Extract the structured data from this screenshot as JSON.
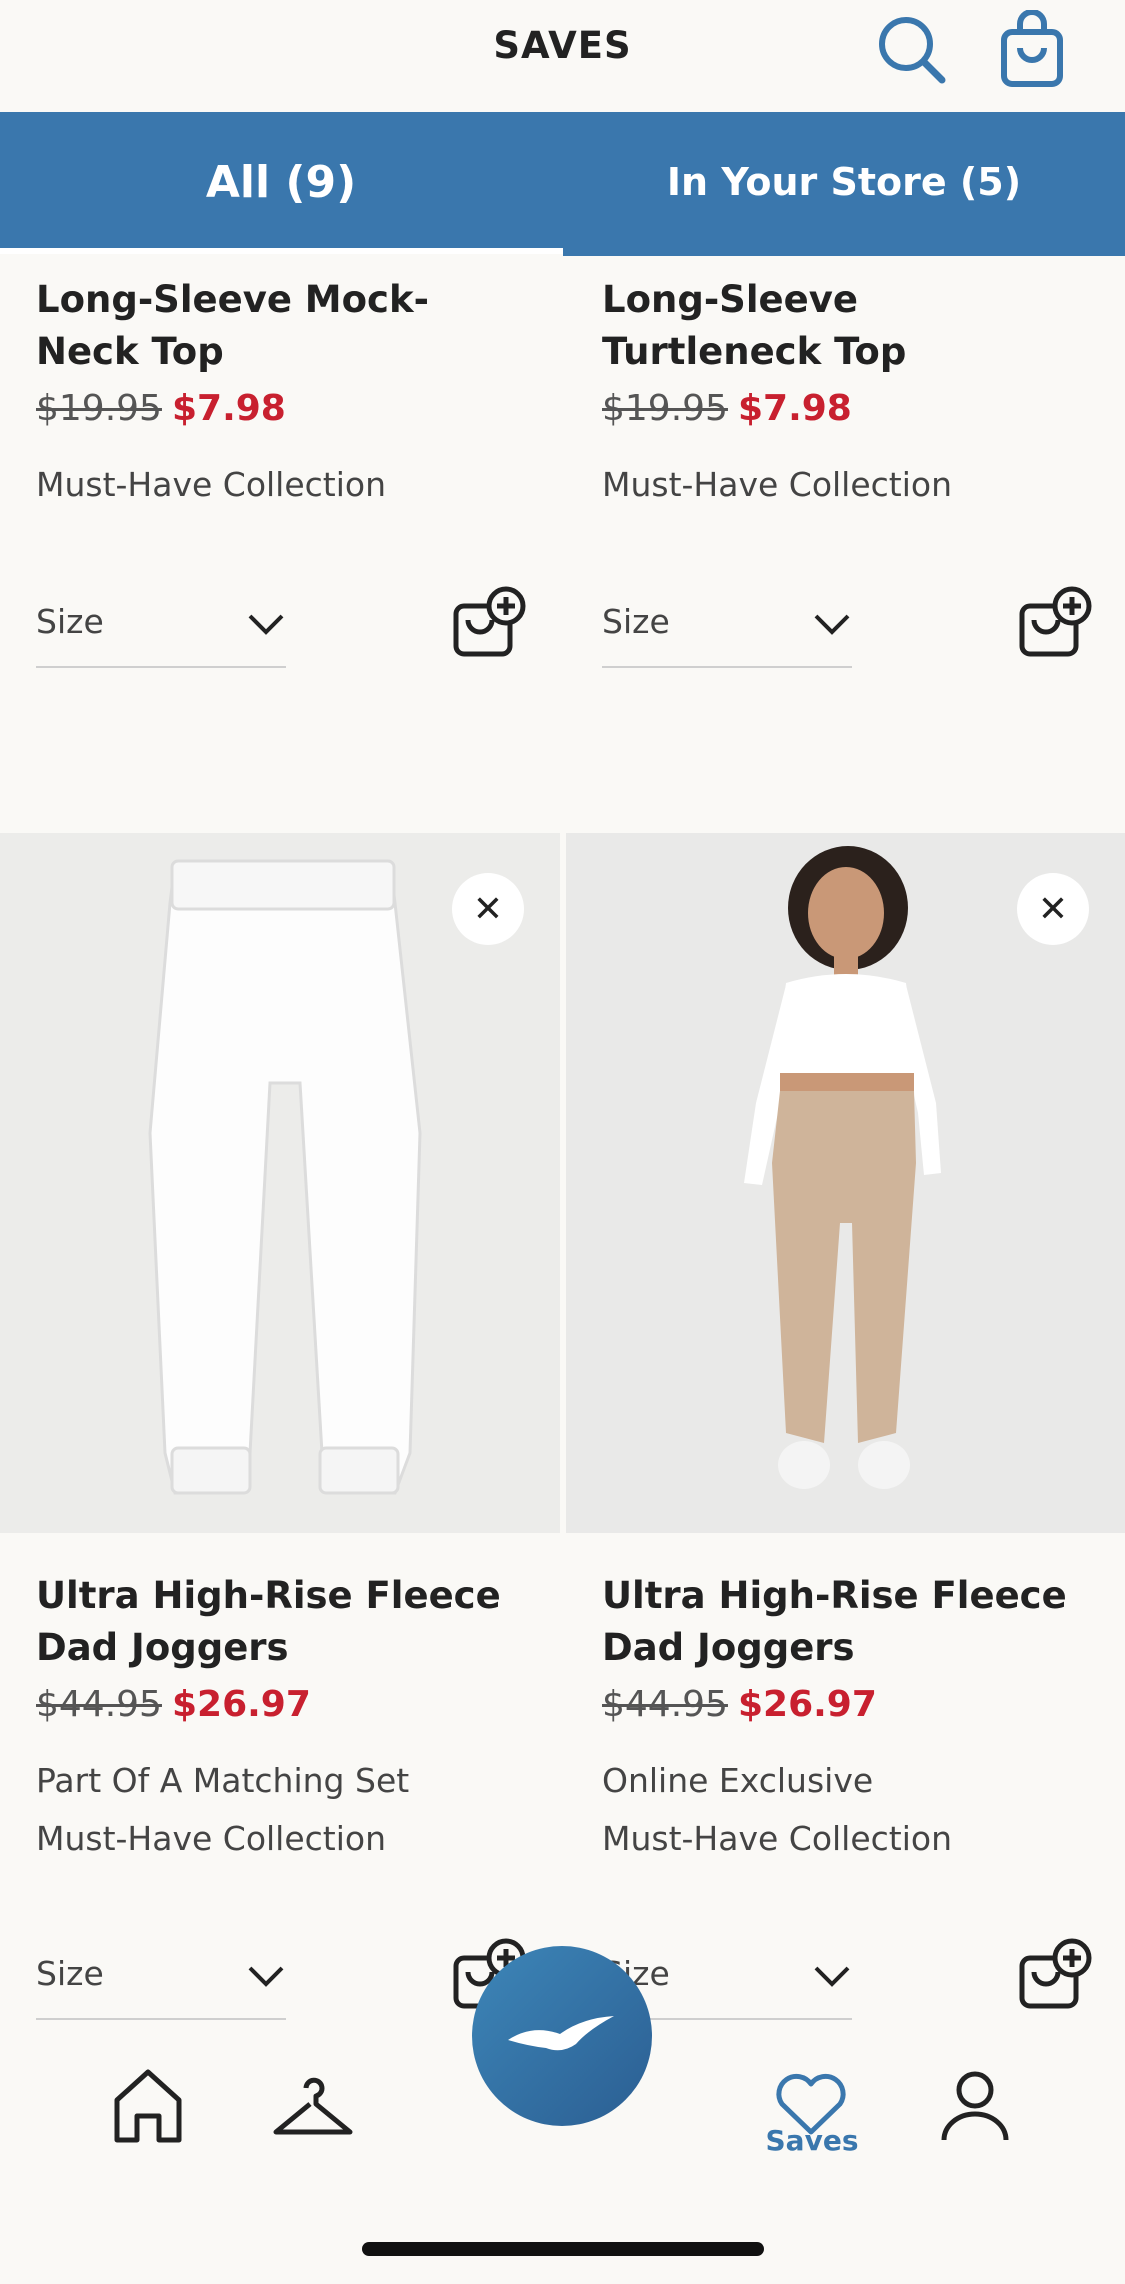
{
  "header": {
    "title": "SAVES"
  },
  "tabs": {
    "all_label": "All (9)",
    "store_label": "In Your Store (5)"
  },
  "products": [
    {
      "name_line1": "Long-Sleeve Mock-",
      "name_line2": "Neck Top",
      "was_price": "$19.95",
      "now_price": "$7.98",
      "tags": [
        "Must-Have Collection"
      ],
      "size_label": "Size"
    },
    {
      "name_line1": "Long-Sleeve",
      "name_line2": "Turtleneck Top",
      "was_price": "$19.95",
      "now_price": "$7.98",
      "tags": [
        "Must-Have Collection"
      ],
      "size_label": "Size"
    },
    {
      "name_line1": "Ultra High-Rise Fleece",
      "name_line2": "Dad Joggers",
      "was_price": "$44.95",
      "now_price": "$26.97",
      "tags": [
        "Part Of A Matching Set",
        "Must-Have Collection"
      ],
      "size_label": "Size"
    },
    {
      "name_line1": "Ultra High-Rise Fleece",
      "name_line2": "Dad Joggers",
      "was_price": "$44.95",
      "now_price": "$26.97",
      "tags": [
        "Online Exclusive",
        "Must-Have Collection"
      ],
      "size_label": "Size"
    }
  ],
  "close_glyph": "✕",
  "nav": {
    "saves_label": "Saves"
  },
  "colors": {
    "brand_blue": "#3a77ad",
    "sale_red": "#c8202f"
  }
}
